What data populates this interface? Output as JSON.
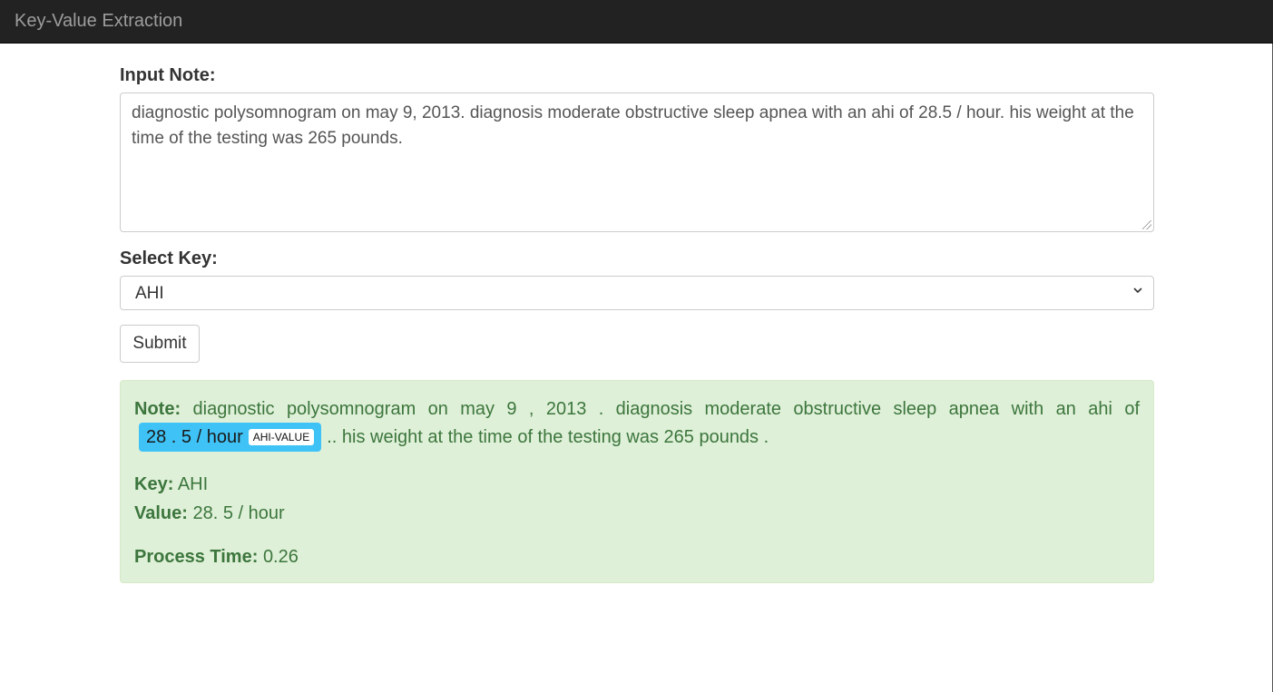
{
  "app": {
    "title": "Key-Value Extraction"
  },
  "form": {
    "note_label": "Input Note:",
    "note_value": "diagnostic polysomnogram on may 9, 2013. diagnosis moderate obstructive sleep apnea with an ahi of 28.5 / hour. his weight at the time of the testing was 265 pounds.",
    "key_label": "Select Key:",
    "key_selected": "AHI",
    "submit_label": "Submit"
  },
  "result": {
    "note_label": "Note:",
    "note_before": "diagnostic polysomnogram on may 9 , 2013 . diagnosis moderate obstructive sleep apnea with an ahi of",
    "entity_text": "28 . 5 / hour",
    "entity_tag": "AHI-VALUE",
    "note_after": ".. his weight at the time of the testing was 265 pounds .",
    "key_label": "Key:",
    "key_value": "AHI",
    "value_label": "Value:",
    "value_value": "28. 5 / hour",
    "process_time_label": "Process Time:",
    "process_time_value": "0.26"
  },
  "colors": {
    "navbar_bg": "#222222",
    "alert_success_bg": "#dff0d8",
    "alert_success_text": "#3c763d",
    "entity_highlight": "#3fc3f7"
  },
  "icons": {
    "select_chevron": "chevron-down-icon",
    "textarea_resize": "resize-grip-icon"
  }
}
